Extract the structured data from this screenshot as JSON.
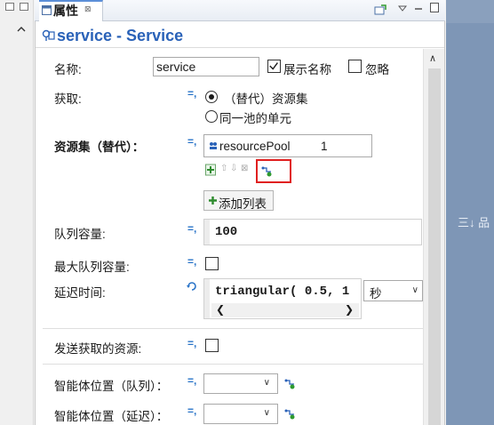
{
  "tab": {
    "title": "属性",
    "close": "⊠"
  },
  "header": {
    "title": "service - Service"
  },
  "fields": {
    "name_label": "名称:",
    "name_value": "service",
    "show_name_label": "展示名称",
    "ignore_label": "忽略",
    "seize_label": "获取:",
    "seize_option1": "（替代）资源集",
    "seize_option2": "同一池的单元",
    "resource_sets_label": "资源集（替代）：",
    "resource_pool_name": "resourcePool",
    "resource_pool_count": "1",
    "add_list_label": "添加列表",
    "queue_capacity_label": "队列容量:",
    "queue_capacity_value": "100",
    "max_queue_label": "最大队列容量:",
    "delay_label": "延迟时间:",
    "delay_value": "triangular( 0.5, 1",
    "delay_unit": "秒",
    "send_seized_label": "发送获取的资源:",
    "agent_loc_queue_label": "智能体位置（队列）：",
    "agent_loc_delay_label": "智能体位置（延迟）：",
    "eq_symbol": "=,"
  },
  "side": {
    "right_icon_text": "三↓ 品"
  },
  "colors": {
    "accent": "#2a62b8",
    "highlight": "#e02020"
  }
}
